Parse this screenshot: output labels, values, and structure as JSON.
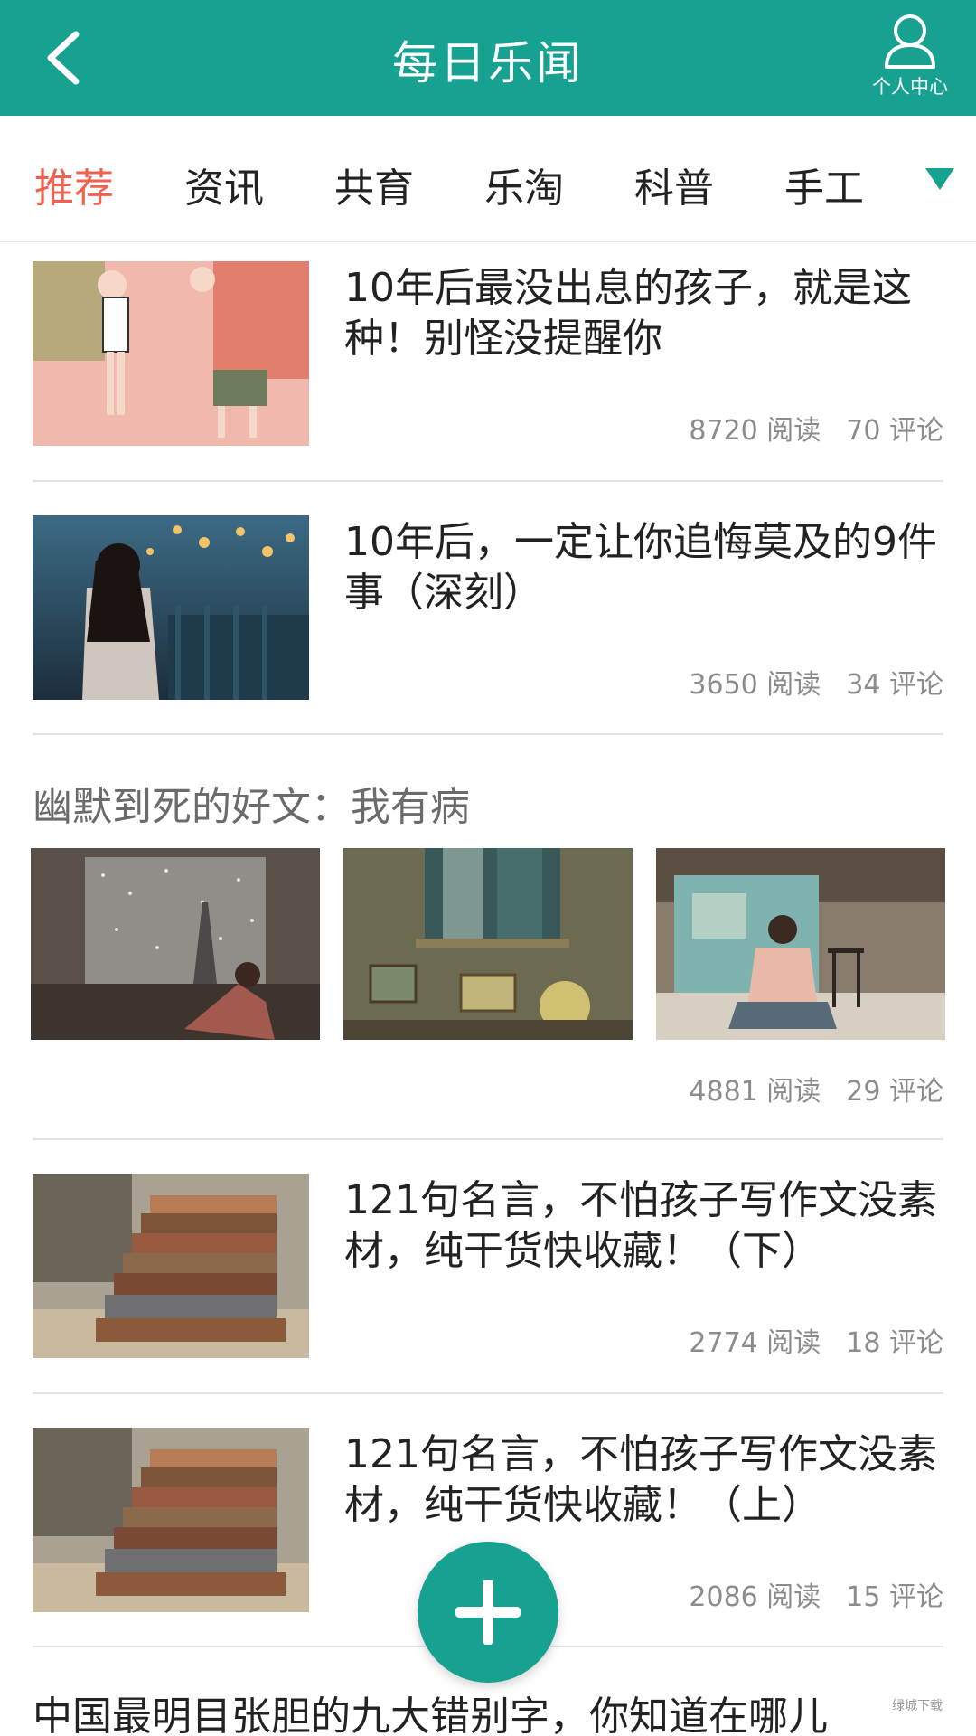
{
  "header": {
    "title": "每日乐闻",
    "profile_label": "个人中心"
  },
  "tabs": [
    "推荐",
    "资讯",
    "共育",
    "乐淘",
    "科普",
    "手工"
  ],
  "active_tab": "推荐",
  "articles": [
    {
      "title": "10年后最没出息的孩子，就是这种！别怪没提醒你",
      "reads": "8720 阅读",
      "comments": "70 评论"
    },
    {
      "title": "10年后，一定让你追悔莫及的9件事（深刻）",
      "reads": "3650 阅读",
      "comments": "34 评论"
    },
    {
      "title": "121句名言，不怕孩子写作文没素材，纯干货快收藏！（下）",
      "reads": "2774 阅读",
      "comments": "18 评论"
    },
    {
      "title": "121句名言，不怕孩子写作文没素材，纯干货快收藏！（上）",
      "reads": "2086 阅读",
      "comments": "15 评论"
    }
  ],
  "gallery_article": {
    "title": "幽默到死的好文：我有病",
    "reads": "4881 阅读",
    "comments": "29 评论"
  },
  "last_article_title": "中国最明目张胆的九大错别字，你知道在哪儿",
  "watermark_text": "绿城下载",
  "colors": {
    "primary": "#17a191",
    "active_tab": "#f0624f"
  }
}
